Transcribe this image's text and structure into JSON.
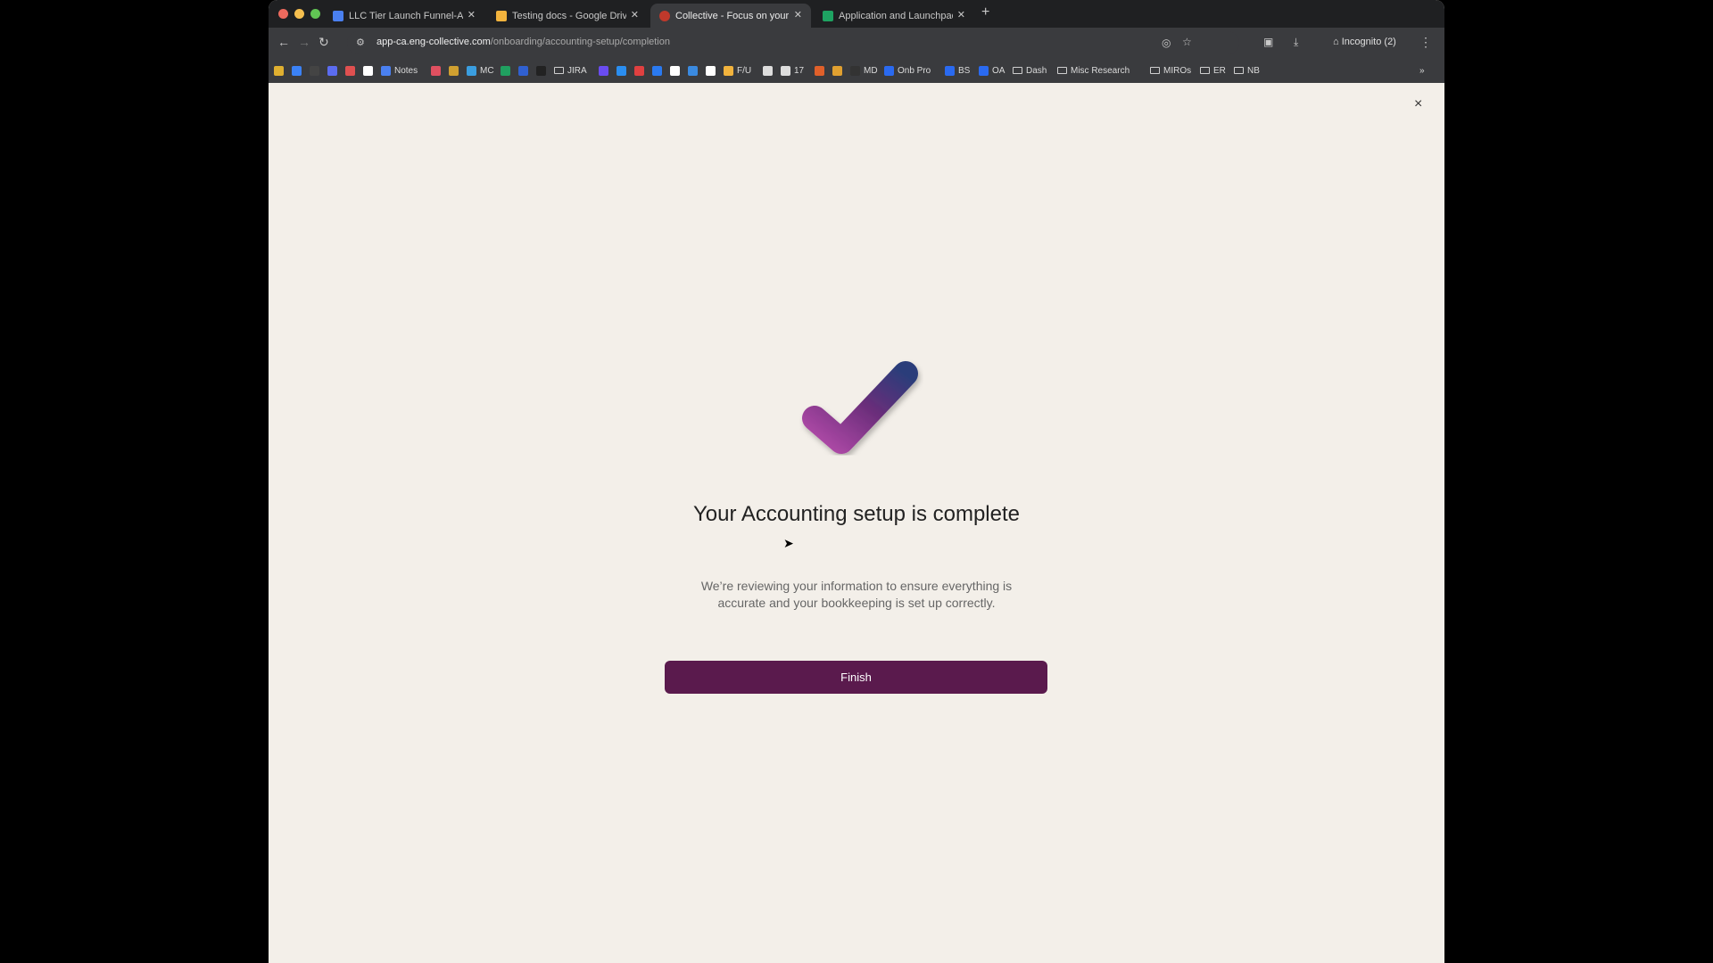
{
  "browser": {
    "tabs": [
      {
        "title": "LLC Tier Launch Funnel-App",
        "favicon_color": "#4a80f0",
        "active": false
      },
      {
        "title": "Testing docs - Google Drive",
        "favicon_color": "#f2b33d",
        "active": false
      },
      {
        "title": "Collective - Focus on your pa",
        "favicon_color": "#c0392b",
        "active": true
      },
      {
        "title": "Application and Launchpad I",
        "favicon_color": "#1ea362",
        "active": false
      }
    ],
    "new_tab": "+",
    "url_host": "app-ca.eng-collective.com",
    "url_path": "/onboarding/accounting-setup/completion",
    "incognito_label": "Incognito (2)",
    "bookmarks": [
      {
        "label": "",
        "icon": "#e0b030"
      },
      {
        "label": "",
        "icon": "#3b82f6"
      },
      {
        "label": "",
        "icon": "#444"
      },
      {
        "label": "",
        "icon": "#5b6cf0"
      },
      {
        "label": "",
        "icon": "#e05050"
      },
      {
        "label": "",
        "icon": "#ffffff"
      },
      {
        "label": "Notes",
        "icon": "#4a80f0"
      },
      {
        "label": "",
        "icon": "#e05060"
      },
      {
        "label": "",
        "icon": "#d0a030"
      },
      {
        "label": "MC",
        "icon": "#3a9ee0"
      },
      {
        "label": "",
        "icon": "#20a060"
      },
      {
        "label": "",
        "icon": "#3060d0"
      },
      {
        "label": "",
        "icon": "#222"
      },
      {
        "label": "JIRA",
        "icon": "folder"
      },
      {
        "label": "",
        "icon": "#6a4cf0"
      },
      {
        "label": "",
        "icon": "#2a8ef0"
      },
      {
        "label": "",
        "icon": "#e04040"
      },
      {
        "label": "",
        "icon": "#2a7af0"
      },
      {
        "label": "",
        "icon": "#ffffff"
      },
      {
        "label": "",
        "icon": "#3a8ae0"
      },
      {
        "label": "",
        "icon": "#ffffff"
      },
      {
        "label": "F/U",
        "icon": "#f2b33d"
      },
      {
        "label": "",
        "icon": "#ddd"
      },
      {
        "label": "17",
        "icon": "#ddd"
      },
      {
        "label": "",
        "icon": "#e0602a"
      },
      {
        "label": "",
        "icon": "#e0a030"
      },
      {
        "label": "MD",
        "icon": "#333"
      },
      {
        "label": "Onb Pro",
        "icon": "#2a6af0"
      },
      {
        "label": "BS",
        "icon": "#2a6af0"
      },
      {
        "label": "OA",
        "icon": "#2a6af0"
      },
      {
        "label": "Dash",
        "icon": "folder"
      },
      {
        "label": "Misc Research",
        "icon": "folder"
      },
      {
        "label": "MIROs",
        "icon": "folder"
      },
      {
        "label": "ER",
        "icon": "folder"
      },
      {
        "label": "NB",
        "icon": "folder"
      }
    ],
    "bookmarks_overflow": "»"
  },
  "page": {
    "close_symbol": "×",
    "title": "Your Accounting setup is complete",
    "subtitle": "We’re reviewing your information to ensure everything is accurate and your bookkeeping is set up correctly.",
    "finish_label": "Finish",
    "check_colors": [
      "#b04aa8",
      "#6a2d7a",
      "#2a3d7a"
    ]
  }
}
